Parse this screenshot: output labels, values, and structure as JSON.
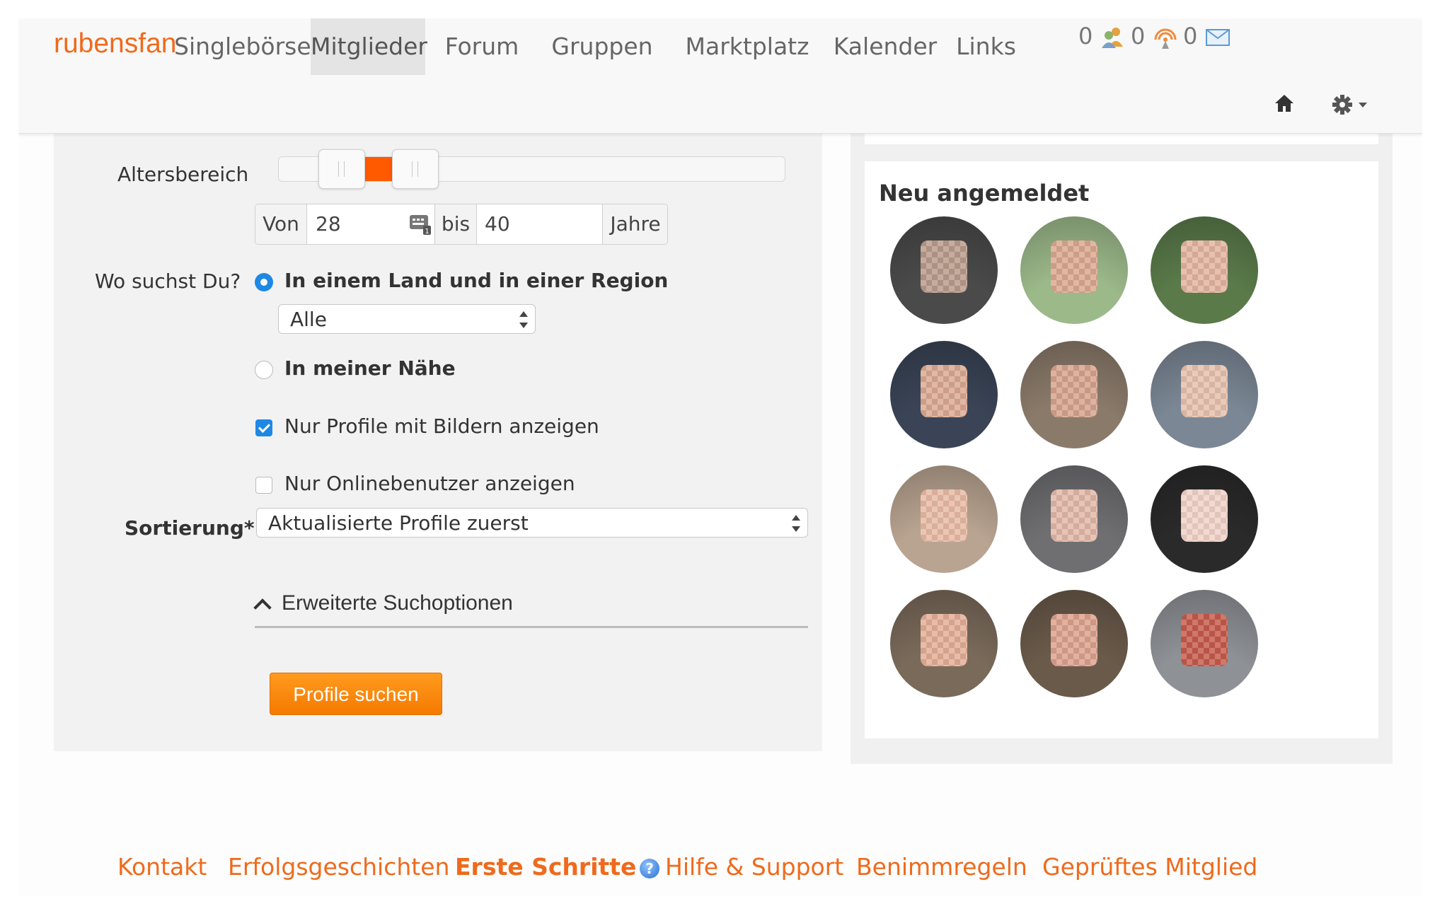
{
  "header": {
    "logo": "rubensfan",
    "nav": [
      {
        "label": "Singlebörse",
        "active": false
      },
      {
        "label": "Mitglieder",
        "active": true
      },
      {
        "label": "Forum",
        "active": false
      },
      {
        "label": "Gruppen",
        "active": false
      },
      {
        "label": "Marktplatz",
        "active": false
      },
      {
        "label": "Kalender",
        "active": false
      },
      {
        "label": "Links",
        "active": false
      }
    ],
    "counters": {
      "contacts": "0",
      "visitors": "0",
      "messages": "0"
    },
    "icons": {
      "contacts": "people-icon",
      "visitors": "radar-icon",
      "messages": "envelope-icon",
      "home": "home-icon",
      "settings": "gear-icon"
    }
  },
  "search": {
    "age_label": "Altersbereich",
    "age_slider": {
      "min_fraction": 0.22,
      "max_fraction": 0.29
    },
    "von_label": "Von",
    "age_from": "28",
    "bis_label": "bis",
    "age_to": "40",
    "jahre_label": "Jahre",
    "where_label": "Wo suchst Du?",
    "option_region": "In einem Land und in einer Region",
    "region_select": "Alle",
    "option_nearby": "In meiner Nähe",
    "only_pictures": "Nur Profile mit Bildern anzeigen",
    "only_online": "Nur Onlinebenutzer anzeigen",
    "sort_label": "Sortierung*",
    "sort_select": "Aktualisierte Profile zuerst",
    "advanced_toggle": "Erweiterte Suchoptionen",
    "submit": "Profile suchen"
  },
  "sidebar": {
    "title": "Neu angemeldet",
    "members": [
      {
        "bg": "#4a4a4a",
        "skin": "#b89a8a"
      },
      {
        "bg": "#9cb98a",
        "skin": "#d9a78f"
      },
      {
        "bg": "#5a7a4a",
        "skin": "#e2b39f"
      },
      {
        "bg": "#3a4456",
        "skin": "#d9a891"
      },
      {
        "bg": "#8a7a6a",
        "skin": "#d4a28c"
      },
      {
        "bg": "#7b8795",
        "skin": "#e4c0ac"
      },
      {
        "bg": "#b9a491",
        "skin": "#e7b9a4"
      },
      {
        "bg": "#6f6f72",
        "skin": "#e0b7a7"
      },
      {
        "bg": "#2a2a2a",
        "skin": "#efd1c7"
      },
      {
        "bg": "#7a6a5a",
        "skin": "#e2ad96"
      },
      {
        "bg": "#6a5a4a",
        "skin": "#dba08c"
      },
      {
        "bg": "#8e9196",
        "skin": "#c45a4a"
      }
    ]
  },
  "footer": {
    "links": [
      "Kontakt",
      "Erfolgsgeschichten",
      "Erste Schritte",
      "Hilfe & Support",
      "Benimmregeln",
      "Geprüftes Mitglied"
    ]
  },
  "colors": {
    "accent": "#ef6a1c",
    "primary": "#1e88e5",
    "button": "#f57a00"
  }
}
